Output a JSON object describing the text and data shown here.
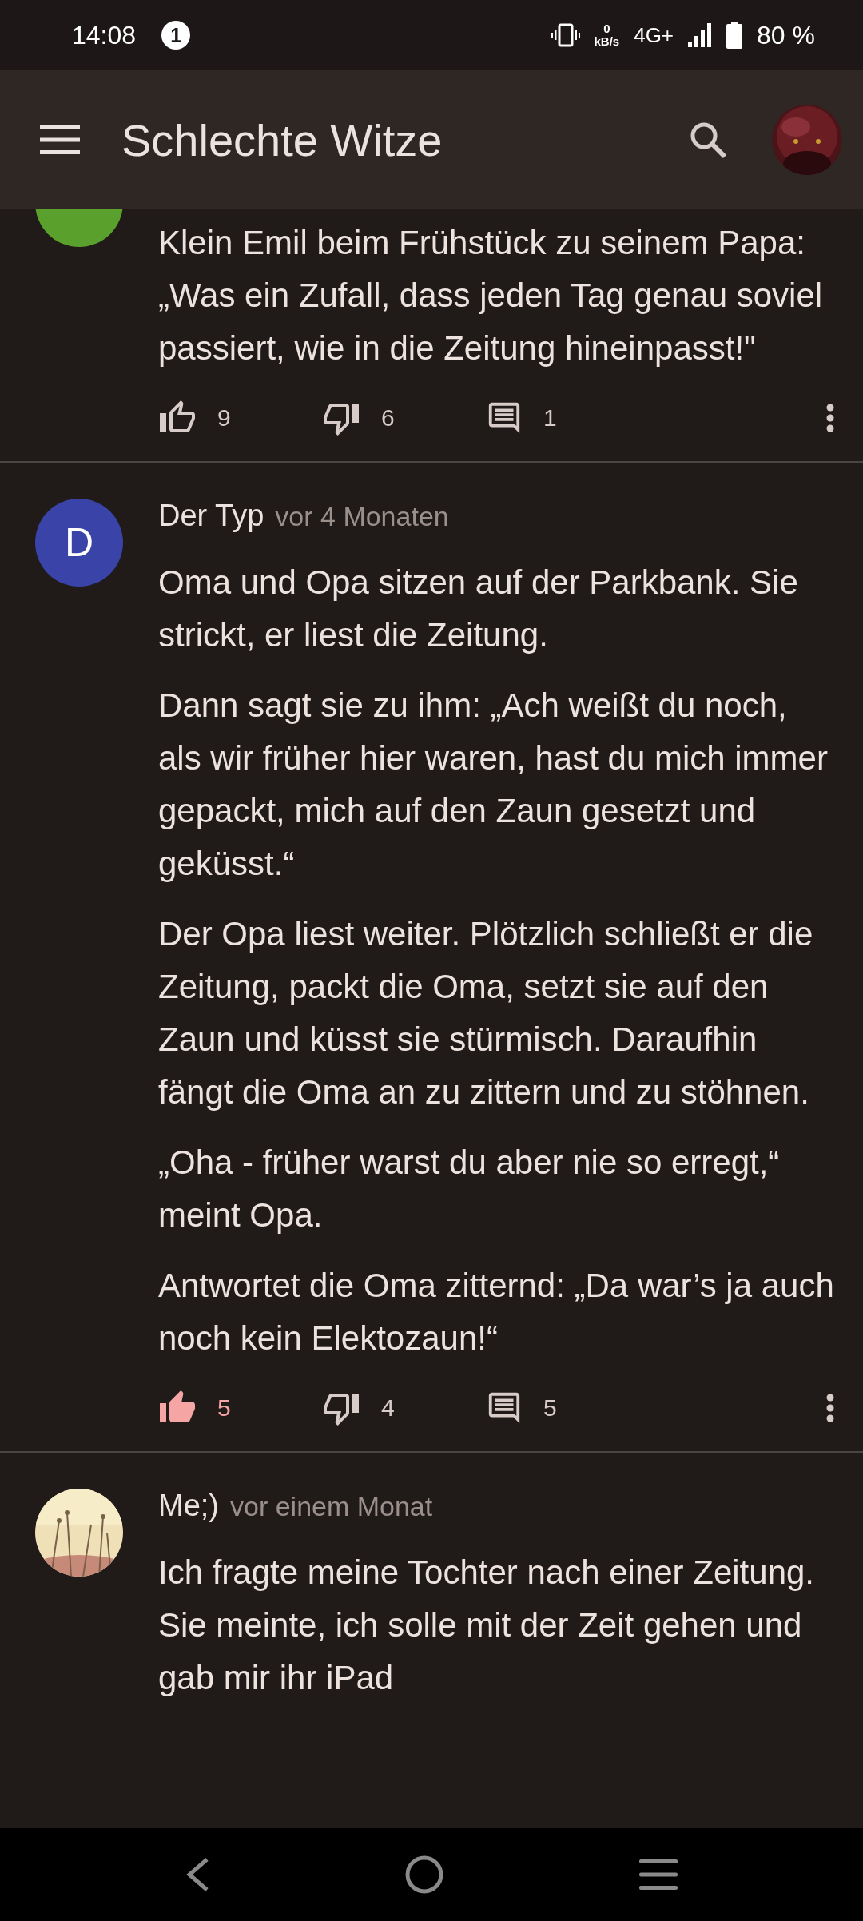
{
  "status_bar": {
    "time": "14:08",
    "notification_count": "1",
    "data_rate": "0",
    "data_unit": "kB/s",
    "network": "4G+",
    "battery": "80 %"
  },
  "app_bar": {
    "title": "Schlechte Witze"
  },
  "posts": [
    {
      "avatar": {
        "kind": "letter",
        "color": "#5aa02c"
      },
      "paragraphs": [
        "Klein Emil beim Frühstück zu seinem Papa: „Was ein Zufall, dass jeden Tag genau soviel passiert, wie in die Zeitung hineinpasst!\""
      ],
      "likes": "9",
      "liked": false,
      "dislikes": "6",
      "disliked": false,
      "comments": "1"
    },
    {
      "avatar": {
        "kind": "letter",
        "color": "#3a44a8",
        "letter": "D"
      },
      "author": "Der Typ",
      "time": "vor 4 Monaten",
      "paragraphs": [
        "Oma und Opa sitzen auf der Parkbank. Sie strickt, er liest die Zeitung.",
        "Dann sagt sie zu ihm: „Ach weißt du noch, als wir früher hier waren, hast du mich immer gepackt, mich auf den Zaun gesetzt und geküsst.“",
        "Der Opa liest weiter. Plötzlich schließt er die Zeitung, packt die Oma, setzt sie auf den Zaun und küsst sie stürmisch. Daraufhin fängt die Oma an zu zittern und zu stöhnen.",
        "„Oha - früher warst du aber nie so erregt,“ meint Opa.",
        "Antwortet die Oma zitternd: „Da war’s ja auch noch kein Elektozaun!“"
      ],
      "likes": "5",
      "liked": true,
      "dislikes": "4",
      "disliked": false,
      "comments": "5"
    },
    {
      "author": "Me;)",
      "time": "vor einem Monat",
      "paragraphs": [
        "Ich fragte meine Tochter nach einer Zeitung. Sie meinte, ich solle mit der Zeit gehen und gab mir ihr iPad"
      ]
    }
  ]
}
